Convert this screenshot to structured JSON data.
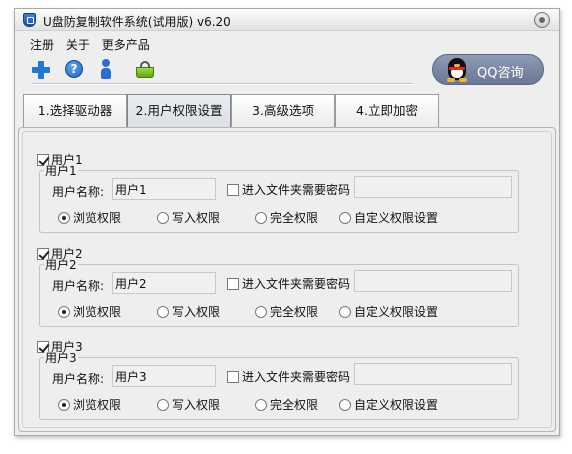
{
  "window": {
    "title": "U盘防复制软件系统(试用版) v6.20"
  },
  "menu": {
    "items": [
      "注册",
      "关于",
      "更多产品"
    ]
  },
  "toolbar": {
    "buttons": [
      "add-icon",
      "help-icon",
      "user-icon",
      "basket-icon"
    ],
    "help_glyph": "?"
  },
  "qq_button": {
    "label": "QQ咨询"
  },
  "tabs": [
    {
      "label": "1.选择驱动器",
      "active": false
    },
    {
      "label": "2.用户权限设置",
      "active": true
    },
    {
      "label": "3.高级选项",
      "active": false
    },
    {
      "label": "4.立即加密",
      "active": false
    }
  ],
  "users": [
    {
      "enabled": true,
      "check_label": "用户1",
      "group_title": "用户1",
      "name_label": "用户名称:",
      "name_value": "用户1",
      "password_check_label": "进入文件夹需要密码",
      "password_required": false,
      "password_value": "",
      "permissions": [
        "浏览权限",
        "写入权限",
        "完全权限",
        "自定义权限设置"
      ],
      "selected_permission": "浏览权限"
    },
    {
      "enabled": true,
      "check_label": "用户2",
      "group_title": "用户2",
      "name_label": "用户名称:",
      "name_value": "用户2",
      "password_check_label": "进入文件夹需要密码",
      "password_required": false,
      "password_value": "",
      "permissions": [
        "浏览权限",
        "写入权限",
        "完全权限",
        "自定义权限设置"
      ],
      "selected_permission": "浏览权限"
    },
    {
      "enabled": true,
      "check_label": "用户3",
      "group_title": "用户3",
      "name_label": "用户名称:",
      "name_value": "用户3",
      "password_check_label": "进入文件夹需要密码",
      "password_required": false,
      "password_value": "",
      "permissions": [
        "浏览权限",
        "写入权限",
        "完全权限",
        "自定义权限设置"
      ],
      "selected_permission": "浏览权限"
    }
  ]
}
